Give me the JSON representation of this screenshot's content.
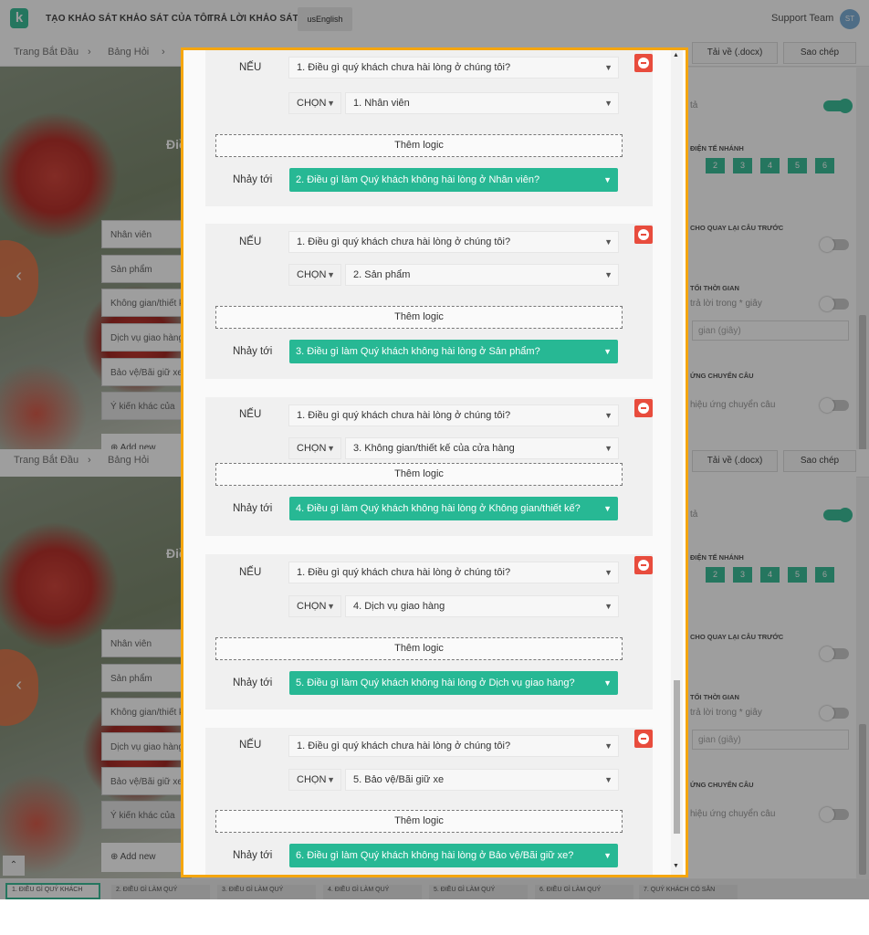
{
  "nav": {
    "items": [
      "TẠO KHẢO SÁT",
      "KHẢO SÁT CỦA TÔI",
      "TRẢ LỜI KHẢO SÁT"
    ],
    "language": "usEnglish",
    "support": "Support Team",
    "avatar": "ST"
  },
  "breadcrumb": {
    "items": [
      "Trang Bắt Đầu",
      "Bảng Hỏi"
    ],
    "download": "Tải về (.docx)",
    "copy": "Sao chép"
  },
  "question_title_fragment": "Điề",
  "choices": [
    "Nhân viên",
    "Sản phẩm",
    "Không gian/thiết kế",
    "Dịch vụ giao hàng",
    "Bảo vệ/Bãi giữ xe",
    "Ý kiến khác của"
  ],
  "add_new": "Add new",
  "right_panel": {
    "label_ta": "tả",
    "branching": "ĐIỆN TẾ NHÁNH",
    "branch_numbers": [
      "2",
      "3",
      "4",
      "5",
      "6"
    ],
    "go_back": "CHO QUAY LẠI CÂU TRƯỚC",
    "time_limit": "TỐI THỜI GIAN",
    "time_hint": "trả lời trong * giây",
    "time_input_placeholder": "gian (giây)",
    "transition": "ỨNG CHUYỂN CÂU",
    "transition_hint": "hiệu ứng chuyển câu"
  },
  "modal": {
    "if_label": "NẾU",
    "choose_label": "CHỌN",
    "add_logic_label": "Thêm logic",
    "jump_label": "Nhảy tới",
    "rules": [
      {
        "question": "1. Điều gì quý khách chưa hài lòng ở chúng tôi?",
        "option": "1. Nhân viên",
        "target": "2. Điều gì làm Quý khách không hài lòng ở Nhân viên?"
      },
      {
        "question": "1. Điều gì quý khách chưa hài lòng ở chúng tôi?",
        "option": "2. Sản phẩm",
        "target": "3. Điều gì làm Quý khách không hài lòng ở Sản phẩm?"
      },
      {
        "question": "1. Điều gì quý khách chưa hài lòng ở chúng tôi?",
        "option": "3. Không gian/thiết kế của cửa hàng",
        "target": "4. Điều gì làm Quý khách không hài lòng ở Không gian/thiết kế?"
      },
      {
        "question": "1. Điều gì quý khách chưa hài lòng ở chúng tôi?",
        "option": "4. Dịch vụ giao hàng",
        "target": "5. Điều gì làm Quý khách không hài lòng ở Dịch vụ giao hàng?"
      },
      {
        "question": "1. Điều gì quý khách chưa hài lòng ở chúng tôi?",
        "option": "5. Bảo vệ/Bãi giữ xe",
        "target": "6. Điều gì làm Quý khách không hài lòng ở Bảo vệ/Bãi giữ xe?"
      }
    ]
  },
  "question_tabs": [
    "1. ĐIỀU GÌ QUÝ KHÁCH",
    "2. ĐIỀU GÌ LÀM QUÝ",
    "3. ĐIỀU GÌ LÀM QUÝ",
    "4. ĐIỀU GÌ LÀM QUÝ",
    "5. ĐIỀU GÌ LÀM QUÝ",
    "6. ĐIỀU GÌ LÀM QUÝ",
    "7. QUÝ KHÁCH CÓ SẴN"
  ],
  "colors": {
    "accent": "#27b894",
    "highlight_border": "#f5a60f",
    "delete": "#e84c3d",
    "prev_button": "#e07a4f"
  }
}
